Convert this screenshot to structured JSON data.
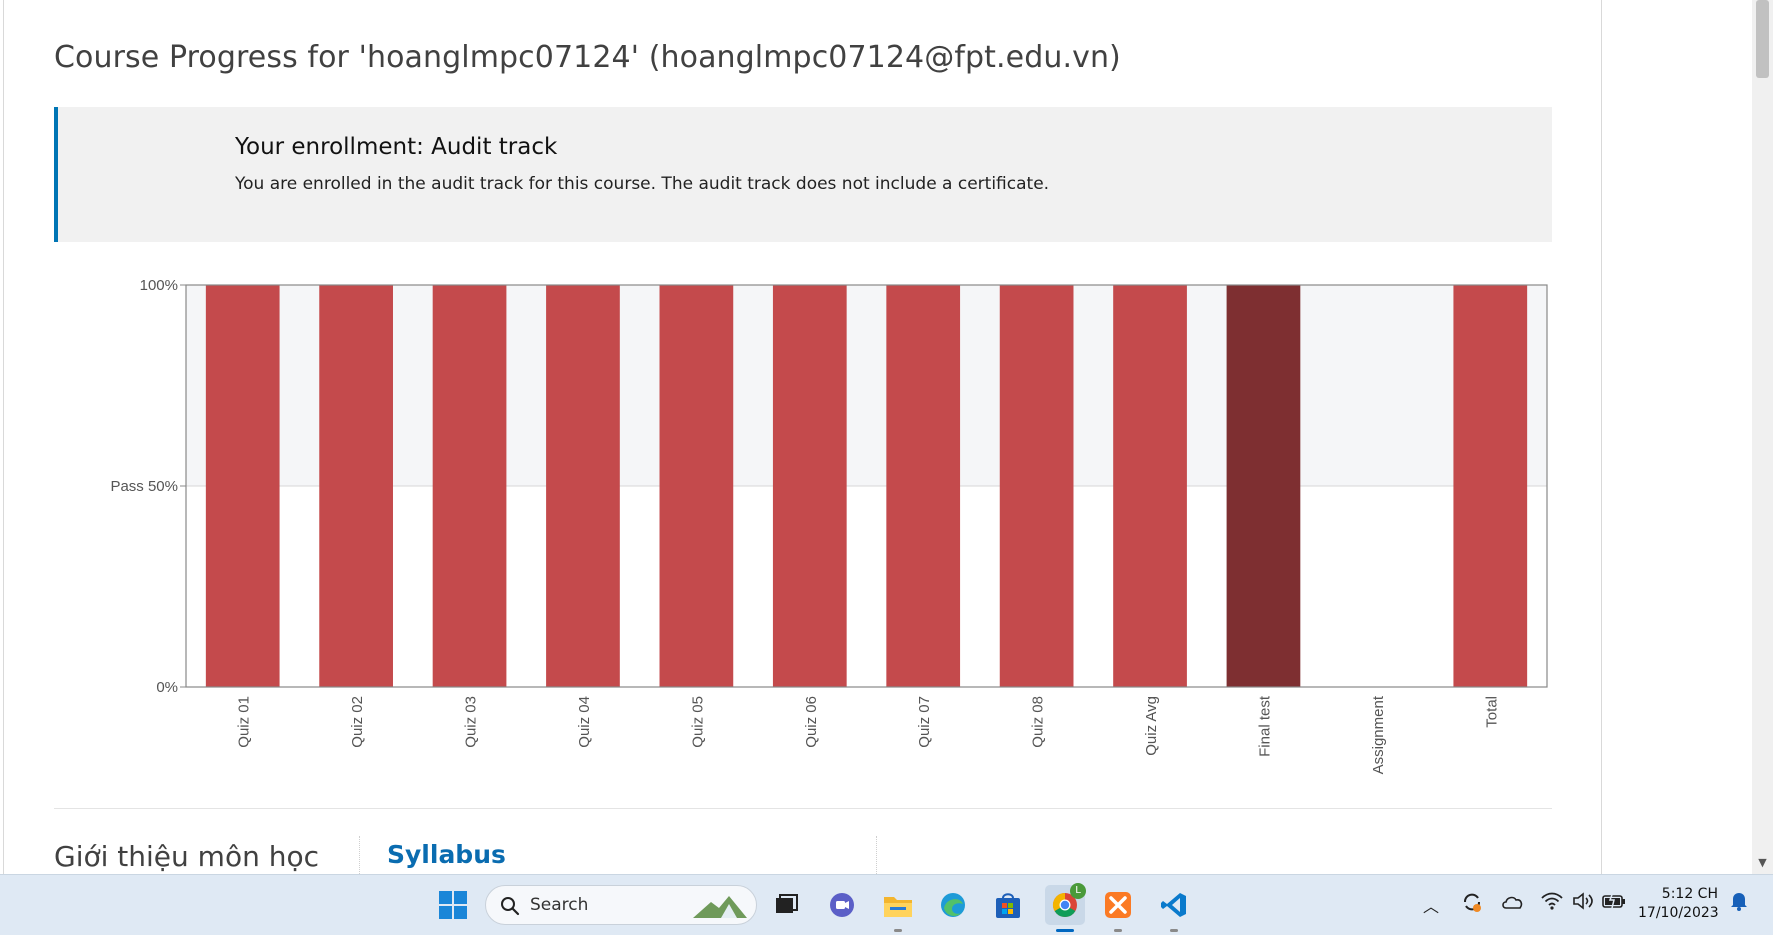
{
  "page": {
    "title": "Course Progress for 'hoanglmpc07124' (hoanglmpc07124@fpt.edu.vn)"
  },
  "enrollment": {
    "heading": "Your enrollment: Audit track",
    "message": "You are enrolled in the audit track for this course. The audit track does not include a certificate."
  },
  "chart_data": {
    "type": "bar",
    "categories": [
      "Quiz 01",
      "Quiz 02",
      "Quiz 03",
      "Quiz 04",
      "Quiz 05",
      "Quiz 06",
      "Quiz 07",
      "Quiz 08",
      "Quiz Avg",
      "Final test",
      "Assignment",
      "Total"
    ],
    "values": [
      100,
      100,
      100,
      100,
      100,
      100,
      100,
      100,
      100,
      100,
      0,
      100
    ],
    "ylim": [
      0,
      100
    ],
    "yticks": [
      {
        "value": 100,
        "label": "100%"
      },
      {
        "value": 50,
        "label": "Pass 50%"
      },
      {
        "value": 0,
        "label": "0%"
      }
    ],
    "pass_threshold": 50,
    "colors": {
      "bar": "#c44a4c",
      "highlight_bar": "#7e2f31",
      "pass_band": "#f5f6f8",
      "axis": "#888888"
    },
    "highlighted_category": "Final test"
  },
  "outline": {
    "section_title": "Giới thiệu môn học",
    "link_label": "Syllabus"
  },
  "taskbar": {
    "search_placeholder": "Search",
    "icons": [
      "windows-start-icon",
      "search-icon",
      "task-view-icon",
      "teams-chat-icon",
      "file-explorer-icon",
      "edge-icon",
      "store-icon",
      "chrome-icon",
      "xampp-icon",
      "vscode-icon"
    ],
    "chrome_badge": "L",
    "clock_time": "5:12 CH",
    "clock_date": "17/10/2023"
  }
}
